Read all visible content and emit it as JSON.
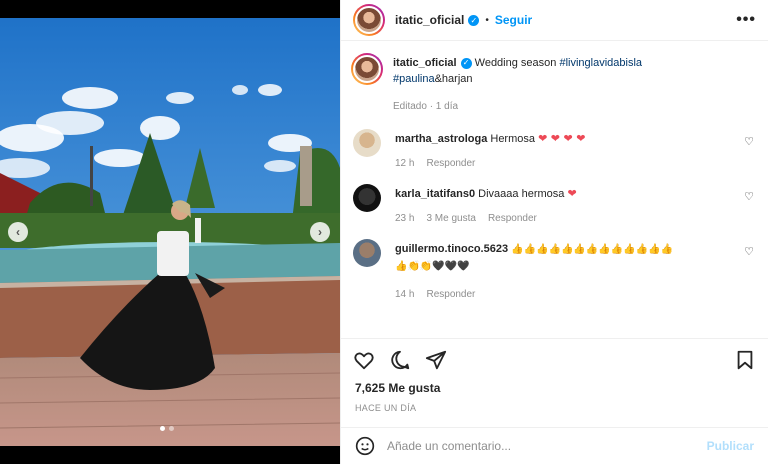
{
  "post": {
    "author": "itatic_oficial",
    "follow_label": "Seguir",
    "more_label": "•••",
    "dot_separator": "•"
  },
  "caption": {
    "username": "itatic_oficial",
    "text": "Wedding season",
    "hashtag1": "#livinglavidabisla",
    "hashtag2": "#paulina",
    "after": "&harjan",
    "edited": "Editado · 1 día"
  },
  "comments": [
    {
      "user": "martha_astrologa",
      "text": "Hermosa",
      "emoji": "❤ ❤ ❤ ❤",
      "time": "12 h",
      "likes": "",
      "reply": "Responder"
    },
    {
      "user": "karla_itatifans0",
      "text": "Divaaaa hermosa",
      "emoji": "❤",
      "time": "23 h",
      "likes": "3 Me gusta",
      "reply": "Responder"
    },
    {
      "user": "guillermo.tinoco.5623",
      "text": "",
      "emoji": "👍👍👍👍👍👍👍👍👍👍👍👍👍",
      "emoji2": "👍👏👏🖤🖤🖤",
      "time": "14 h",
      "likes": "",
      "reply": "Responder"
    }
  ],
  "likes": "7,625 Me gusta",
  "timestamp": "HACE UN DÍA",
  "add_comment": {
    "placeholder": "Añade un comentario...",
    "post_label": "Publicar"
  },
  "icons": {
    "nav_prev": "chevron-left-icon",
    "nav_next": "chevron-right-icon",
    "like": "heart-icon",
    "comment": "comment-icon",
    "share": "send-icon",
    "save": "bookmark-icon",
    "emoji": "emoji-icon",
    "verified": "verified-badge-icon"
  },
  "colors": {
    "accent": "#0095f6",
    "heart": "#ed4956",
    "muted": "#8e8e8e",
    "post_disabled": "#b2dffc"
  },
  "carousel": {
    "count": 2,
    "active": 0
  }
}
